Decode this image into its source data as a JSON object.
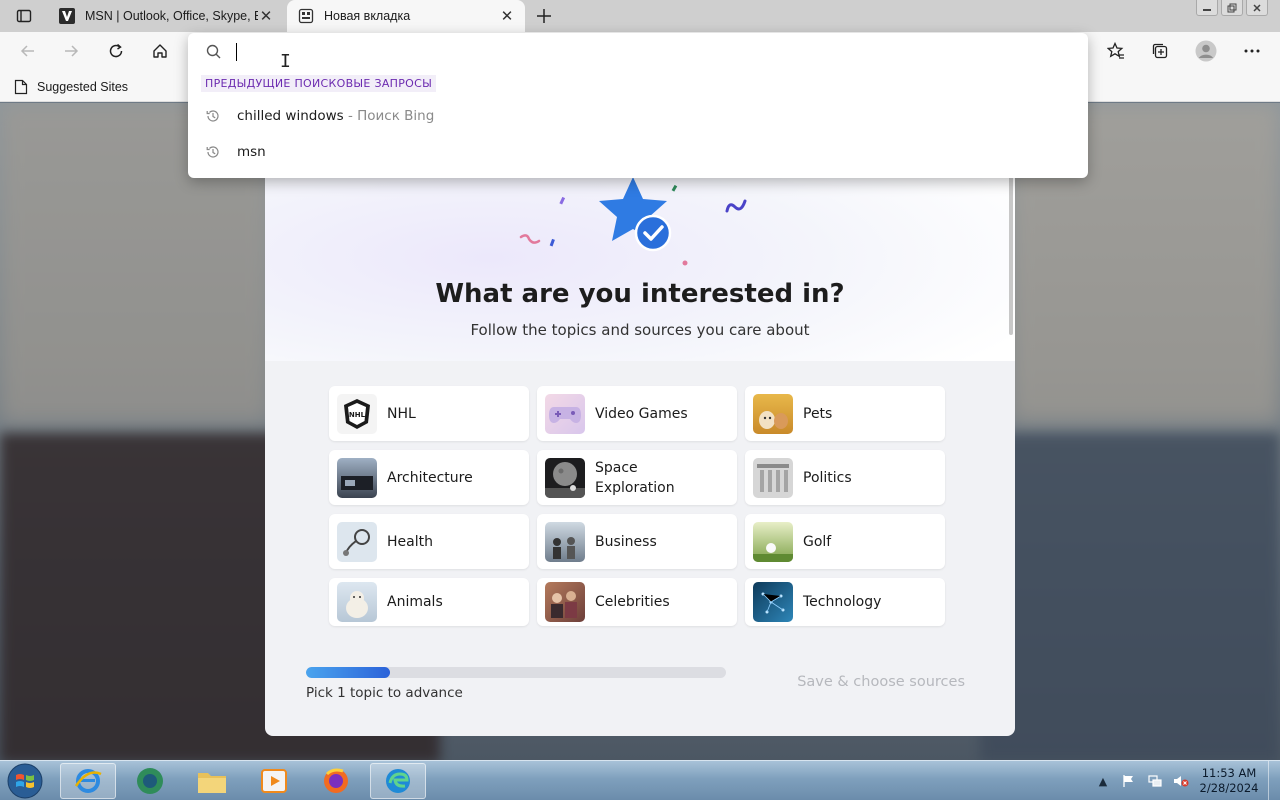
{
  "browser": {
    "tabs": [
      {
        "title": "MSN | Outlook, Office, Skype, Bi",
        "favicon": "msn-icon",
        "active": false
      },
      {
        "title": "Новая вкладка",
        "favicon": "new-tab-page-icon",
        "active": true
      }
    ],
    "favorites": [
      {
        "label": "Suggested Sites",
        "icon": "page-icon"
      }
    ]
  },
  "address_dropdown": {
    "input_value": "",
    "section_header": "ПРЕДЫДУЩИЕ ПОИСКОВЫЕ ЗАПРОСЫ",
    "suggestions": [
      {
        "text": "chilled windows",
        "hint": " - Поиск Bing",
        "icon": "history-icon"
      },
      {
        "text": "msn",
        "hint": "",
        "icon": "history-icon"
      }
    ]
  },
  "dialog": {
    "title": "What are you interested in?",
    "subtitle": "Follow the topics and sources you care about",
    "topics": [
      {
        "label": "NHL"
      },
      {
        "label": "Video Games"
      },
      {
        "label": "Pets"
      },
      {
        "label": "Architecture"
      },
      {
        "label": "Space Exploration"
      },
      {
        "label": "Politics"
      },
      {
        "label": "Health"
      },
      {
        "label": "Business"
      },
      {
        "label": "Golf"
      },
      {
        "label": "Animals"
      },
      {
        "label": "Celebrities"
      },
      {
        "label": "Technology"
      }
    ],
    "progress_fraction": 0.2,
    "progress_text": "Pick 1 topic to advance",
    "save_label": "Save & choose sources"
  },
  "taskbar": {
    "apps": [
      "internet-explorer-icon",
      "media-center-icon",
      "file-explorer-icon",
      "media-player-icon",
      "firefox-icon",
      "edge-icon"
    ],
    "clock_time": "11:53 AM",
    "clock_date": "2/28/2024"
  },
  "colors": {
    "accent": "#6c2bb0",
    "progress": "#2b62d9",
    "taskbar": "#7fa0bd"
  }
}
